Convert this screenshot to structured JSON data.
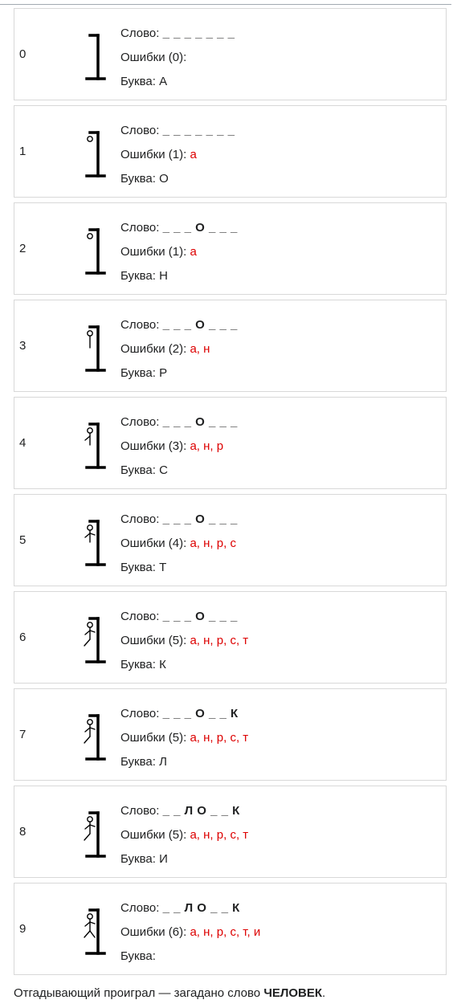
{
  "labels": {
    "word": "Слово:",
    "misses": "Ошибки",
    "letter": "Буква:"
  },
  "colors": {
    "error": "#dd0000",
    "border": "#d8d8d8",
    "text": "#202122"
  },
  "rows": [
    {
      "index": "0",
      "stage": 0,
      "word": "_ _ _ _ _ _ _",
      "miss_count": "(0):",
      "misses": "",
      "letter": "А"
    },
    {
      "index": "1",
      "stage": 1,
      "word": "_ _ _ _ _ _ _",
      "miss_count": "(1):",
      "misses": "а",
      "letter": "О"
    },
    {
      "index": "2",
      "stage": 1,
      "word": "_ _ _ О _ _ _",
      "miss_count": "(1):",
      "misses": "а",
      "letter": "Н"
    },
    {
      "index": "3",
      "stage": 2,
      "word": "_ _ _ О _ _ _",
      "miss_count": "(2):",
      "misses": "а, н",
      "letter": "Р"
    },
    {
      "index": "4",
      "stage": 3,
      "word": "_ _ _ О _ _ _",
      "miss_count": "(3):",
      "misses": "а, н, р",
      "letter": "С"
    },
    {
      "index": "5",
      "stage": 4,
      "word": "_ _ _ О _ _ _",
      "miss_count": "(4):",
      "misses": "а, н, р, с",
      "letter": "Т"
    },
    {
      "index": "6",
      "stage": 5,
      "word": "_ _ _ О _ _ _",
      "miss_count": "(5):",
      "misses": "а, н, р, с, т",
      "letter": "К"
    },
    {
      "index": "7",
      "stage": 5,
      "word": "_ _ _ О _ _ К",
      "miss_count": "(5):",
      "misses": "а, н, р, с, т",
      "letter": "Л"
    },
    {
      "index": "8",
      "stage": 5,
      "word": "_ _ Л О _ _ К",
      "miss_count": "(5):",
      "misses": "а, н, р, с, т",
      "letter": "И"
    },
    {
      "index": "9",
      "stage": 6,
      "word": "_ _ Л О _ _ К",
      "miss_count": "(6):",
      "misses": "а, н, р, с, т, и",
      "letter": ""
    }
  ],
  "footer": {
    "text_before": "Отгадывающий проиграл — загадано слово ",
    "answer": "ЧЕЛОВЕК",
    "text_after": "."
  }
}
